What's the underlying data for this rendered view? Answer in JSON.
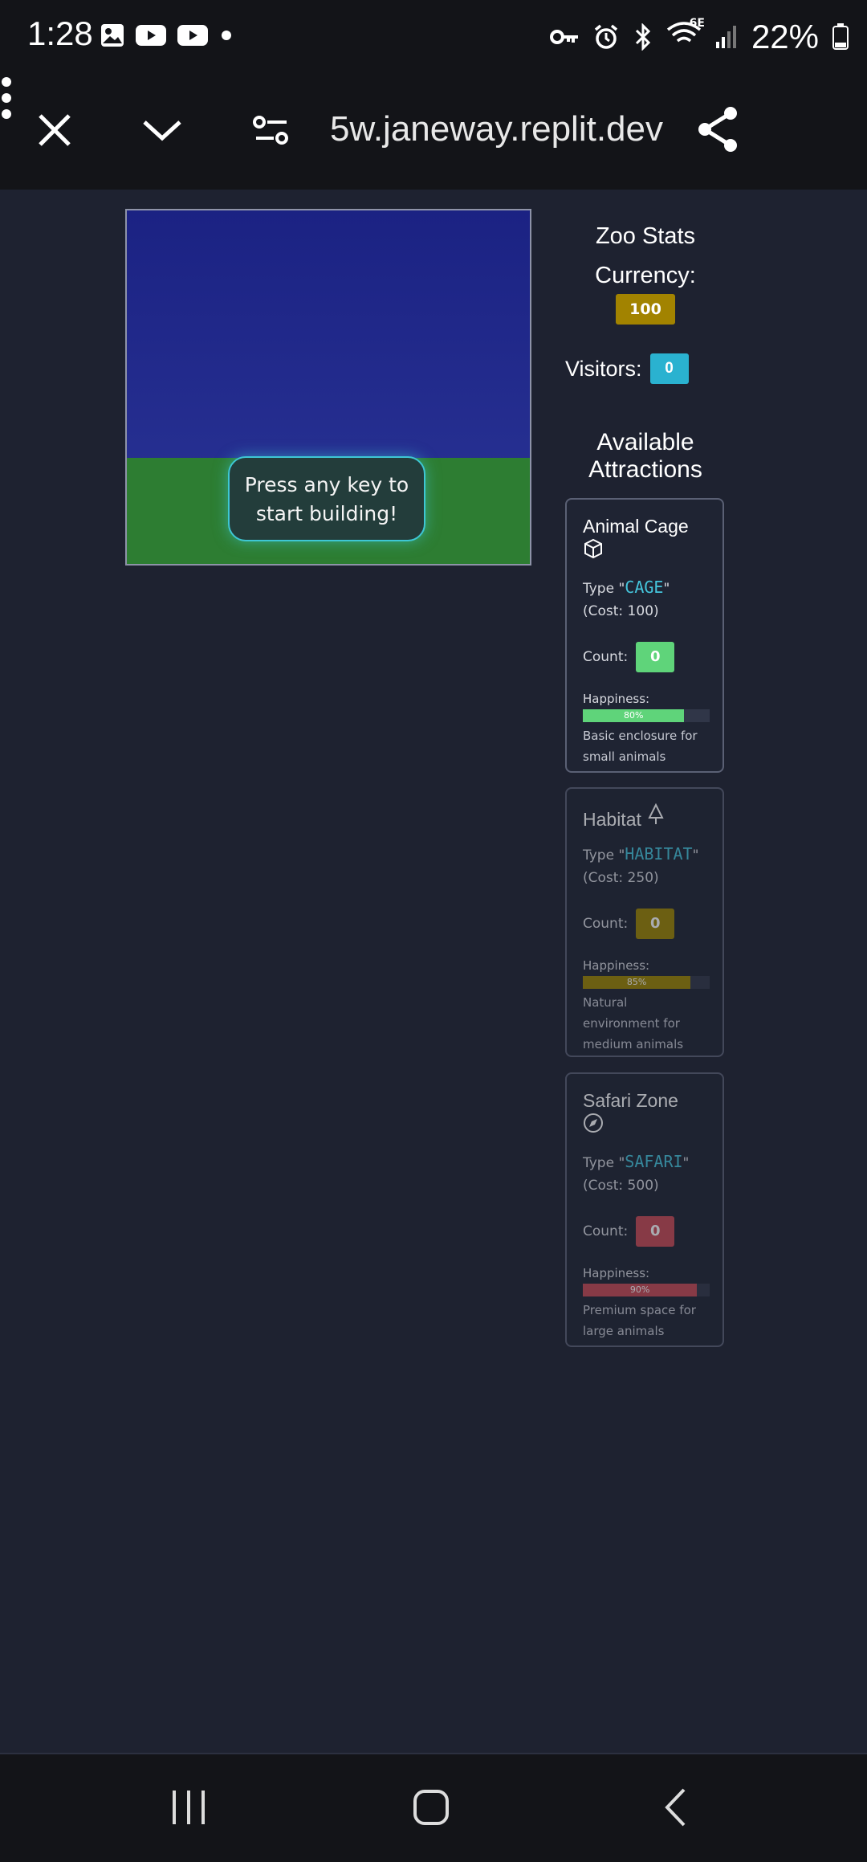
{
  "status_bar": {
    "time": "1:28",
    "battery": "22%",
    "network_label": "6E"
  },
  "browser": {
    "url": "5w.janeway.replit.dev"
  },
  "game": {
    "prompt": "Press any key to start building!"
  },
  "stats": {
    "title": "Zoo Stats",
    "currency_label": "Currency:",
    "currency_value": "100",
    "visitors_label": "Visitors:",
    "visitors_value": "0"
  },
  "attractions": {
    "title": "Available Attractions",
    "items": [
      {
        "name": "Animal Cage",
        "icon": "cube-icon",
        "type_prefix": "Type \"",
        "type_code": "CAGE",
        "type_suffix": "\"",
        "cost": "(Cost: 100)",
        "count_label": "Count:",
        "count": "0",
        "happiness_label": "Happiness:",
        "happiness": "80%",
        "happiness_fraction": 0.8,
        "color": "#5fd47a",
        "description": "Basic enclosure for small animals"
      },
      {
        "name": "Habitat",
        "icon": "tree-icon",
        "type_prefix": "Type \"",
        "type_code": "HABITAT",
        "type_suffix": "\"",
        "cost": "(Cost: 250)",
        "count_label": "Count:",
        "count": "0",
        "happiness_label": "Happiness:",
        "happiness": "85%",
        "happiness_fraction": 0.85,
        "color": "#9c8500",
        "description": "Natural environment for medium animals"
      },
      {
        "name": "Safari Zone",
        "icon": "compass-icon",
        "type_prefix": "Type \"",
        "type_code": "SAFARI",
        "type_suffix": "\"",
        "cost": "(Cost: 500)",
        "count_label": "Count:",
        "count": "0",
        "happiness_label": "Happiness:",
        "happiness": "90%",
        "happiness_fraction": 0.9,
        "color": "#c84a55",
        "description": "Premium space for large animals"
      }
    ]
  }
}
